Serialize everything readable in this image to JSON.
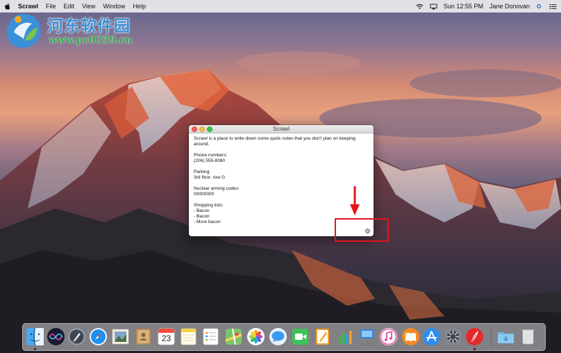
{
  "menubar": {
    "app_name": "Scrawl",
    "menus": [
      "File",
      "Edit",
      "View",
      "Window",
      "Help"
    ],
    "clock": "Sun 12:55 PM",
    "user": "Jane Donovan"
  },
  "watermark": {
    "line1": "河东软件园",
    "line2": "www.pc0359.cn"
  },
  "window": {
    "title": "Scrawl",
    "note_lines": [
      "Scrawl is a place to write down some quick notes that you don't plan on keeping",
      "around.",
      "",
      "Phone numbers:",
      "(206) 555-8080",
      "",
      "Parking:",
      "3rd floor, row G",
      "",
      "Nuclear arming codes:",
      "00000000",
      "",
      "Shopping lists:",
      "- Bacon",
      "- Bacon",
      "- More bacon"
    ]
  },
  "dock": {
    "calendar_day": "23",
    "icons": [
      "finder-icon",
      "siri-icon",
      "launchpad-icon",
      "safari-icon",
      "mail-icon",
      "contacts-icon",
      "calendar-icon",
      "notes-icon",
      "reminders-icon",
      "maps-icon",
      "photos-icon",
      "messages-icon",
      "facetime-icon",
      "pages-icon",
      "numbers-icon",
      "keynote-icon",
      "itunes-icon",
      "ibooks-icon",
      "app-store-icon",
      "system-preferences-icon",
      "scrawl-icon",
      "downloads-folder-icon",
      "trash-icon"
    ]
  },
  "colors": {
    "annotation": "#e3151c",
    "watermark_blue": "#3b8fd6",
    "watermark_green": "#2fa84a"
  }
}
